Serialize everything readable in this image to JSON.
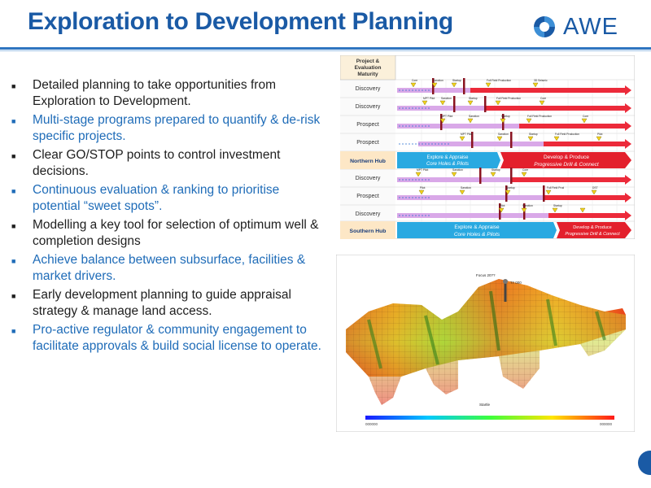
{
  "title": "Exploration to Development Planning",
  "logo": {
    "text": "AWE"
  },
  "bullets": [
    {
      "text": "Detailed planning to take opportunities from Exploration to Development.",
      "color": "dark"
    },
    {
      "text": "Multi-stage programs prepared to quantify & de-risk specific projects.",
      "color": "blue"
    },
    {
      "text": "Clear GO/STOP points to control investment decisions.",
      "color": "dark"
    },
    {
      "text": "Continuous evaluation & ranking to prioritise potential “sweet spots”.",
      "color": "blue"
    },
    {
      "text": "Modelling a key tool for selection of optimum well & completion designs",
      "color": "dark"
    },
    {
      "text": "Achieve balance between subsurface, facilities & market drivers.",
      "color": "blue"
    },
    {
      "text": "Early development planning to guide appraisal strategy & manage land access.",
      "color": "dark"
    },
    {
      "text": "Pro-active regulator & community engagement to facilitate approvals & build social license to operate.",
      "color": "blue"
    }
  ],
  "diagram": {
    "header": "Project & Evaluation Maturity",
    "rows": [
      "Discovery",
      "Discovery",
      "Prospect",
      "Prospect",
      "Northern Hub",
      "Discovery",
      "Prospect",
      "Discovery",
      "Southern Hub"
    ],
    "northern_left_line1": "Explore & Appraise",
    "northern_left_line2": "Core Holes & Pilots",
    "northern_right_line1": "Develop & Produce",
    "northern_right_line2": "Progressive Drill & Connect",
    "southern_left_line1": "Explore & Appraise",
    "southern_left_line2": "Core Holes & Pilots",
    "southern_right_line1": "Develop & Produce",
    "southern_right_line2": "Progressive Drill & Connect",
    "milestone_labels": [
      "Core",
      "Sanction",
      "Startup",
      "Full Field Production",
      "3D Seismic",
      "MPT Pilot",
      "Sanction",
      "Startup",
      "Full Field Production",
      "Core",
      "MPT Pilot",
      "Sanction",
      "Startup",
      "Full Field Production",
      "Core",
      "MPT Pilot",
      "Sanction",
      "Startup",
      "Full Field Production",
      "Pilot",
      "MPT Pilot",
      "Sanction",
      "Startup",
      "Core",
      "Pilot",
      "Sanction",
      "Startup",
      "Full Field Prod",
      "DST",
      "Pilot",
      "Sanction",
      "Startup"
    ]
  },
  "model": {
    "well_label": "Focus 20??",
    "well_label2": "?? 000",
    "colorbar_min": "000000",
    "colorbar_max": "000000",
    "axis_label": "Startle"
  }
}
